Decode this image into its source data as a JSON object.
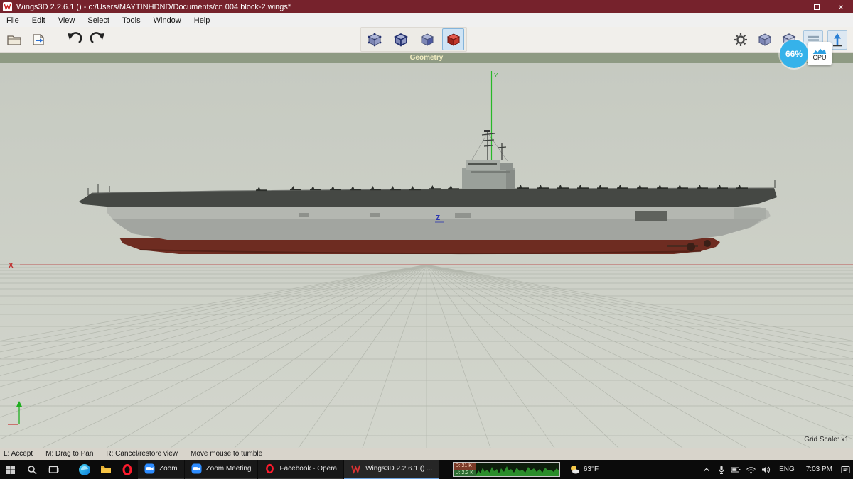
{
  "titlebar": {
    "title": "Wings3D 2.2.6.1 () - c:/Users/MAYTINHDND/Documents/cn 004 block-2.wings*"
  },
  "menu": {
    "items": [
      "File",
      "Edit",
      "View",
      "Select",
      "Tools",
      "Window",
      "Help"
    ]
  },
  "geometry_bar": {
    "label": "Geometry"
  },
  "overlay": {
    "progress": "66%",
    "cpu_label": "CPU"
  },
  "viewport": {
    "x_axis_label": "X",
    "y_axis_label": "Y",
    "z_axis_label": "Z",
    "grid_scale_label": "Grid Scale: x1"
  },
  "status": {
    "segments": [
      "L: Accept",
      "M: Drag to Pan",
      "R: Cancel/restore view",
      "Move mouse to tumble"
    ]
  },
  "taskbar": {
    "apps": [
      {
        "label": "Zoom"
      },
      {
        "label": "Zoom Meeting"
      },
      {
        "label": "Facebook - Opera"
      },
      {
        "label": "Wings3D 2.2.6.1 () ..."
      }
    ],
    "net": {
      "down": "D: 21 K",
      "up": "U: 2.2 K"
    },
    "weather": "63°F",
    "language": "ENG",
    "time": "7:03 PM"
  },
  "icons": {
    "titlebar": "wings3d-logo-icon",
    "toolbar_left": [
      "open-file-icon",
      "import-icon",
      "undo-icon",
      "redo-icon"
    ],
    "toolbar_modes": [
      "vertex-mode-icon",
      "edge-mode-icon",
      "face-mode-icon",
      "body-mode-icon"
    ],
    "toolbar_right": [
      "settings-gear-icon",
      "smooth-cube-icon",
      "wire-cube-icon",
      "ground-plane-icon",
      "view-axis-icon"
    ],
    "taskbar_left": [
      "start-icon",
      "search-icon",
      "task-view-icon",
      "edge-browser-icon",
      "folder-icon",
      "opera-icon"
    ],
    "tray": [
      "chevron-up-icon",
      "microphone-icon",
      "battery-icon",
      "wifi-icon",
      "volume-icon",
      "notification-icon"
    ]
  },
  "colors": {
    "title_red": "#76222c",
    "overlay_blue": "#35b2ea",
    "select_red": "#cc2a2a",
    "grid_bg": "#c9cdc4"
  }
}
